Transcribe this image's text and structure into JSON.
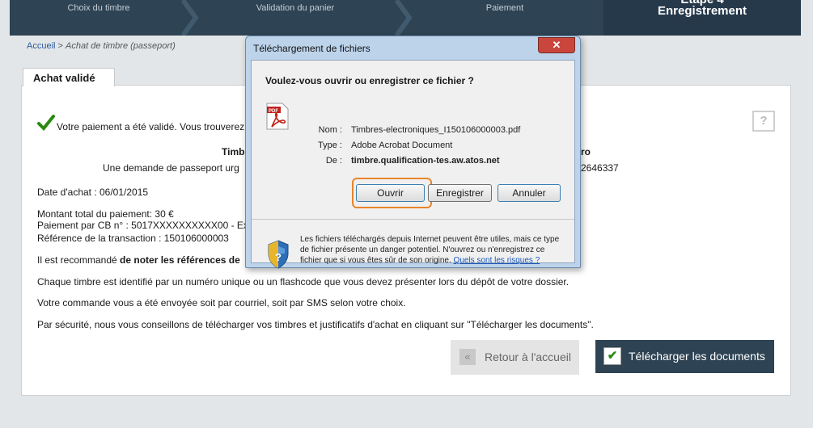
{
  "steps": {
    "items": [
      "Choix du timbre",
      "Validation du panier",
      "Paiement"
    ],
    "active_top": "Étape 4",
    "active": "Enregistrement"
  },
  "breadcrumb": {
    "home": "Accueil",
    "separator": ">",
    "current": "Achat de timbre (passeport)"
  },
  "tab": {
    "label": "Achat validé"
  },
  "help": {
    "label": "?"
  },
  "content": {
    "payment_ok": "Votre paiement a été validé. Vous trouverez",
    "table_header_left": "Timbr",
    "table_header_right": "ro",
    "table_row_left": "Une demande de passeport urg",
    "table_row_right": "2646337",
    "date": "Date d'achat : 06/01/2015",
    "amount": "Montant total du paiement: 30 €",
    "card": "Paiement par CB n° : 5017XXXXXXXXXX00 - Exp",
    "reference": "Référence de la transaction : 150106000003",
    "recommend_prefix": "Il est recommandé ",
    "recommend_bold": "de noter les références de",
    "unique": "Chaque timbre est identifié par un numéro unique ou un flashcode que vous devez présenter lors du dépôt de votre dossier.",
    "sent": "Votre commande vous a été envoyée soit par courriel, soit par SMS selon votre choix.",
    "security": "Par sécurité, nous vous conseillons de télécharger vos timbres et justificatifs d'achat en cliquant sur \"Télécharger les documents\"."
  },
  "buttons": {
    "back": "Retour à l'accueil",
    "download": "Télécharger les documents",
    "back_icon": "«",
    "download_icon": "✔"
  },
  "dialog": {
    "title": "Téléchargement de fichiers",
    "close_label": "✕",
    "question": "Voulez-vous ouvrir ou enregistrer ce fichier ?",
    "name_label": "Nom :",
    "name_value": "Timbres-electroniques_I150106000003.pdf",
    "type_label": "Type :",
    "type_value": "Adobe Acrobat Document",
    "from_label": "De :",
    "from_value": "timbre.qualification-tes.aw.atos.net",
    "open_button": "Ouvrir",
    "save_button": "Enregistrer",
    "cancel_button": "Annuler",
    "warning": "Les fichiers téléchargés depuis Internet peuvent être utiles, mais ce type de fichier présente un danger potentiel. N'ouvrez ou n'enregistrez ce fichier que si vous êtes sûr de son origine. ",
    "warning_link": "Quels sont les risques ?"
  },
  "colors": {
    "header": "#2e4353",
    "accent_focus": "#e8842a",
    "check": "#2a8a10",
    "pdf_red": "#c0211a"
  }
}
